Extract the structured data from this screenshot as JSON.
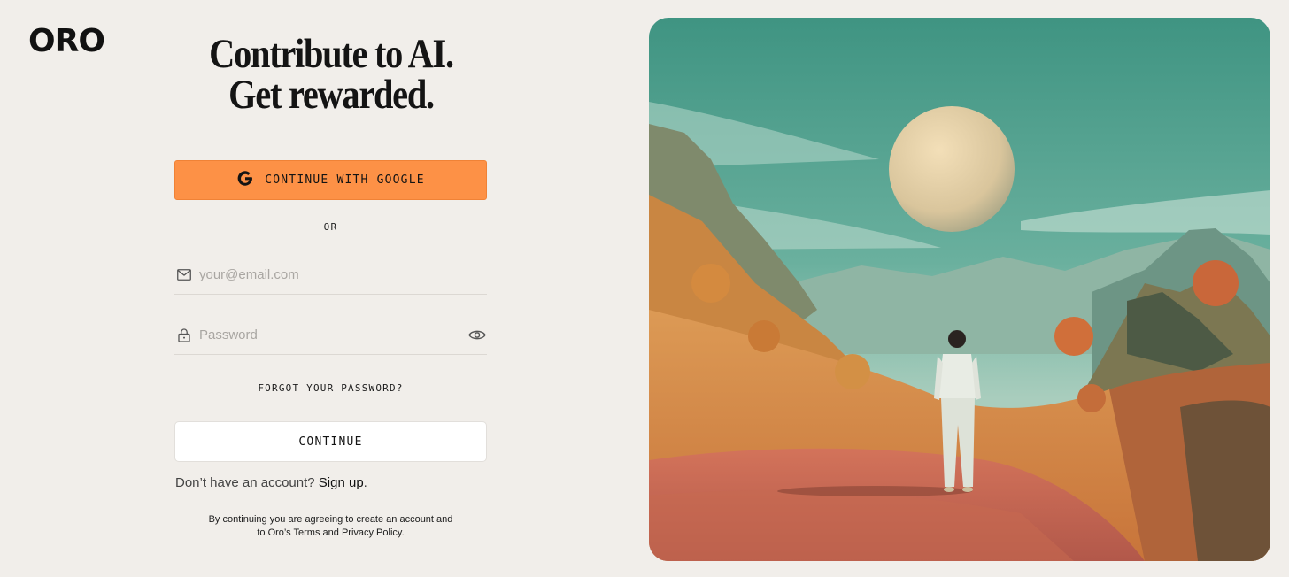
{
  "brand": {
    "logo_text": "ORO"
  },
  "headline": {
    "line1": "Contribute to AI.",
    "line2": "Get rewarded."
  },
  "google_button": {
    "label": "CONTINUE WITH GOOGLE",
    "icon": "google-g-icon",
    "color": "#fd9146"
  },
  "divider": {
    "label": "OR"
  },
  "email_field": {
    "placeholder": "your@email.com",
    "value": "",
    "icon": "mail-icon"
  },
  "password_field": {
    "placeholder": "Password",
    "value": "",
    "icon": "lock-icon",
    "toggle_icon": "eye-icon"
  },
  "forgot_password": {
    "label": "FORGOT YOUR PASSWORD?"
  },
  "continue_button": {
    "label": "CONTINUE"
  },
  "signup": {
    "prompt": "Don’t have an account?",
    "link": "Sign up",
    "suffix": "."
  },
  "legal": {
    "text": "By continuing you are agreeing to create an account and to Oro’s Terms and Privacy Policy."
  },
  "hero_image": {
    "subject": "illustration of a person in white standing on an orange alien landscape under a large pale planet in a teal sky"
  },
  "colors": {
    "background": "#f1eeea",
    "accent": "#fd9146",
    "sky": "#4f9d8a",
    "ground": "#d98d45"
  }
}
